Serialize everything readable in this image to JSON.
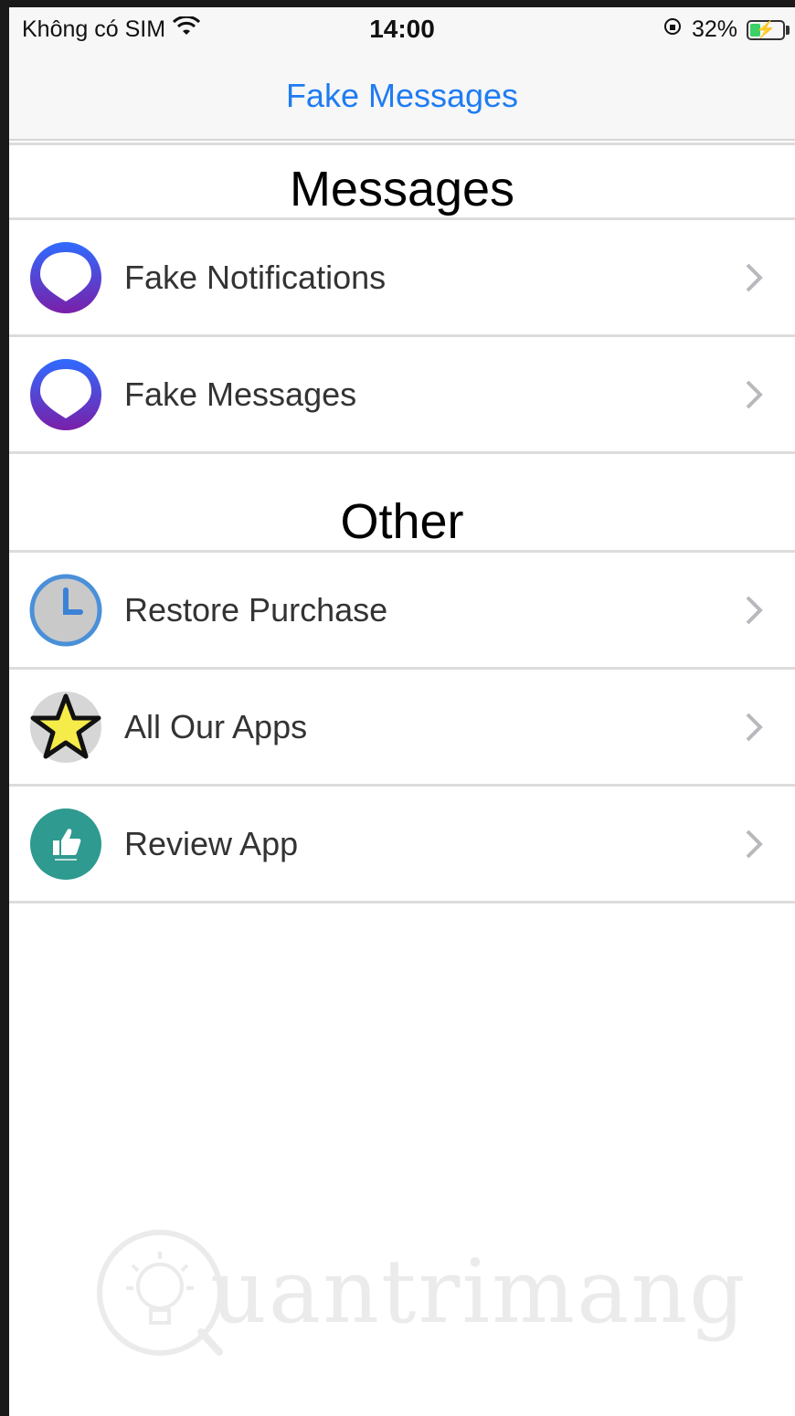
{
  "status_bar": {
    "carrier": "Không có SIM",
    "time": "14:00",
    "battery_percent": "32%",
    "battery_level": 0.32,
    "icons": [
      "wifi-icon",
      "orientation-lock-icon",
      "battery-charging-icon"
    ]
  },
  "nav": {
    "title": "Fake Messages",
    "title_color": "#1f7cf2"
  },
  "sections": {
    "messages": {
      "header": "Messages",
      "rows": [
        {
          "label": "Fake Notifications",
          "icon": "chat-bubble-icon"
        },
        {
          "label": "Fake Messages",
          "icon": "chat-bubble-icon"
        }
      ]
    },
    "other": {
      "header": "Other",
      "rows": [
        {
          "label": "Restore Purchase",
          "icon": "clock-icon"
        },
        {
          "label": "All Our Apps",
          "icon": "star-icon"
        },
        {
          "label": "Review App",
          "icon": "thumbs-up-icon"
        }
      ]
    }
  },
  "watermark": {
    "text": "uantrimang"
  },
  "colors": {
    "accent": "#1f7cf2",
    "bubble_gradient_top": "#2f6bff",
    "bubble_gradient_bottom": "#7a1fa8",
    "review_teal": "#2e9a90",
    "star_yellow": "#f5ec4a"
  }
}
